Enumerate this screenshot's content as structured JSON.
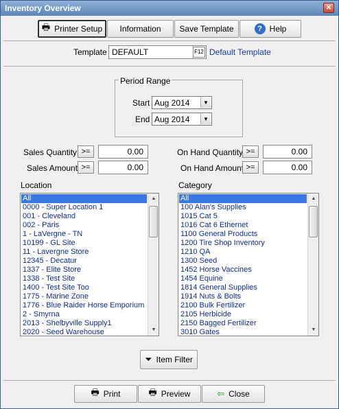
{
  "window": {
    "title": "Inventory Overview",
    "close_glyph": "✕"
  },
  "toolbar": {
    "printer_setup": "Printer Setup",
    "information": "Information",
    "save_template": "Save Template",
    "help": "Help"
  },
  "template": {
    "label": "Template",
    "value": "DEFAULT",
    "lookup_key": "F12",
    "description": "Default Template"
  },
  "period": {
    "title": "Period Range",
    "start_label": "Start",
    "start_value": "Aug 2014",
    "end_label": "End",
    "end_value": "Aug 2014"
  },
  "filters": {
    "sales_quantity": {
      "label": "Sales Quantity",
      "operator": ">=",
      "value": "0.00"
    },
    "sales_amount": {
      "label": "Sales Amount",
      "operator": ">=",
      "value": "0.00"
    },
    "on_hand_quantity": {
      "label": "On Hand Quantity",
      "operator": ">=",
      "value": "0.00"
    },
    "on_hand_amount": {
      "label": "On Hand Amount",
      "operator": ">=",
      "value": "0.00"
    }
  },
  "location": {
    "label": "Location",
    "items": [
      "All",
      "0000 - Super Location 1",
      "001 - Cleveland",
      "002 - Paris",
      "1 - LaVergne - TN",
      "10199 - GL Site",
      "11 - Lavergne Store",
      "12345 - Decatur",
      "1337 - Elite Store",
      "1338 - Test Site",
      "1400 - Test Site Too",
      "1775 - Marine Zone",
      "1776 - Blue Raider Horse Emporium",
      "2 - Smyrna",
      "2013 - Shelbyville Supply1",
      "2020 - Seed Warehouse"
    ]
  },
  "category": {
    "label": "Category",
    "items": [
      "All",
      "100 Alan's Supplies",
      "1015 Cat 5",
      "1016 Cat 6 Ethernet",
      "1100 General Products",
      "1200 Tire Shop Inventory",
      "1210 QA",
      "1300 Seed",
      "1452 Horse Vaccines",
      "1454 Equine",
      "1814 General Supplies",
      "1914 Nuts & Bolts",
      "2100 Bulk Fertilizer",
      "2105 Herbicide",
      "2150 Bagged Fertilizer",
      "3010 Gates"
    ]
  },
  "item_filter": "Item Filter",
  "footer": {
    "print": "Print",
    "preview": "Preview",
    "close": "Close"
  },
  "icons": {
    "printer": "🖶",
    "help": "?",
    "funnel": "⏷",
    "print": "🖶",
    "preview": "🖶",
    "close": "⇦",
    "scroll_up": "▲",
    "scroll_down": "▼",
    "combo_arrow": "▼"
  }
}
